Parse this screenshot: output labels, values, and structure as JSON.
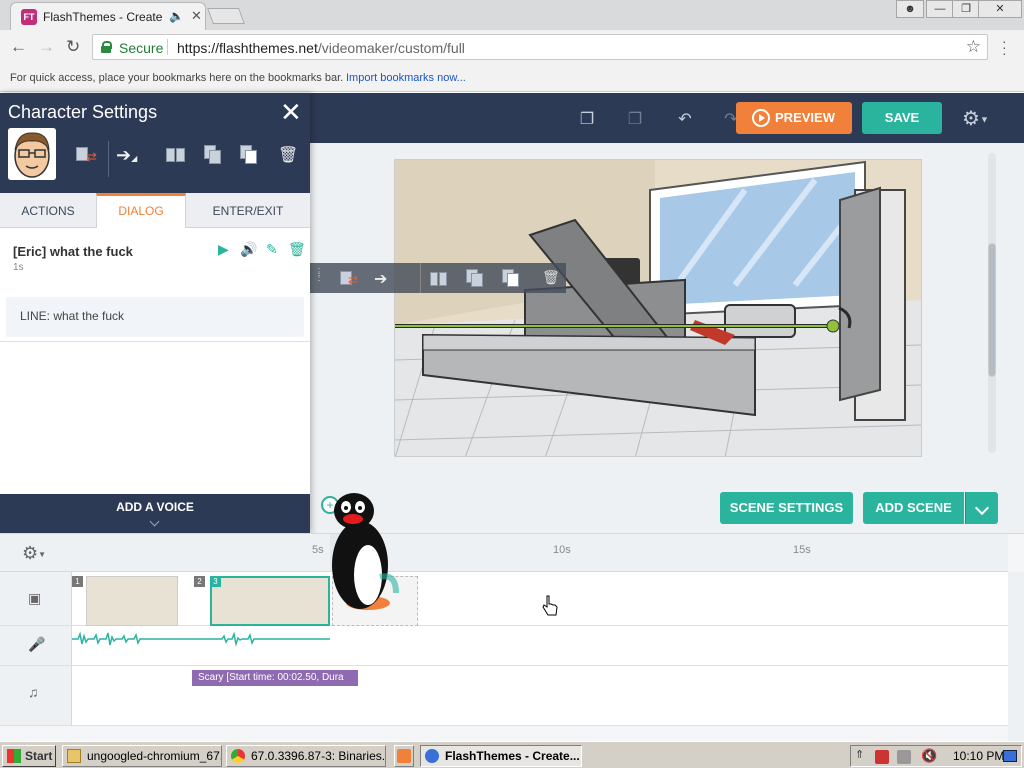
{
  "browser": {
    "tab_title": "FlashThemes - Create",
    "tab_favicon_text": "FT",
    "url_secure_label": "Secure",
    "url_host": "https://flashthemes.net",
    "url_path": "/videomaker/custom/full",
    "bookmarks_hint": "For quick access, place your bookmarks here on the bookmarks bar.",
    "import_bookmarks_link": "Import bookmarks now..."
  },
  "app_header": {
    "preview_label": "PREVIEW",
    "save_label": "SAVE"
  },
  "character_panel": {
    "title": "Character Settings",
    "tabs": [
      {
        "label": "ACTIONS"
      },
      {
        "label": "DIALOG",
        "active": true
      },
      {
        "label": "ENTER/EXIT"
      }
    ],
    "dialog": {
      "name": "[Eric] what the fuck",
      "duration": "1s",
      "line": "LINE: what the fuck"
    },
    "add_voice_label": "ADD A VOICE"
  },
  "stage": {
    "scene_settings_label": "SCENE SETTINGS",
    "add_scene_label": "ADD SCENE"
  },
  "timeline": {
    "ticks": [
      "5s",
      "10s",
      "15s"
    ],
    "scene_numbers": [
      "1",
      "2",
      "3"
    ],
    "music_clip_label": "Scary [Start time: 00:02.50, Dura"
  },
  "taskbar": {
    "start_label": "Start",
    "items": [
      {
        "label": "ungoogled-chromium_67...."
      },
      {
        "label": "67.0.3396.87-3: Binaries..."
      },
      {
        "label": "FlashThemes - Create..."
      }
    ],
    "clock": "10:10 PM"
  },
  "colors": {
    "accent_orange": "#f1803a",
    "accent_teal": "#2ab49e",
    "header_navy": "#2d3a55",
    "music_purple": "#8e6bb0"
  }
}
